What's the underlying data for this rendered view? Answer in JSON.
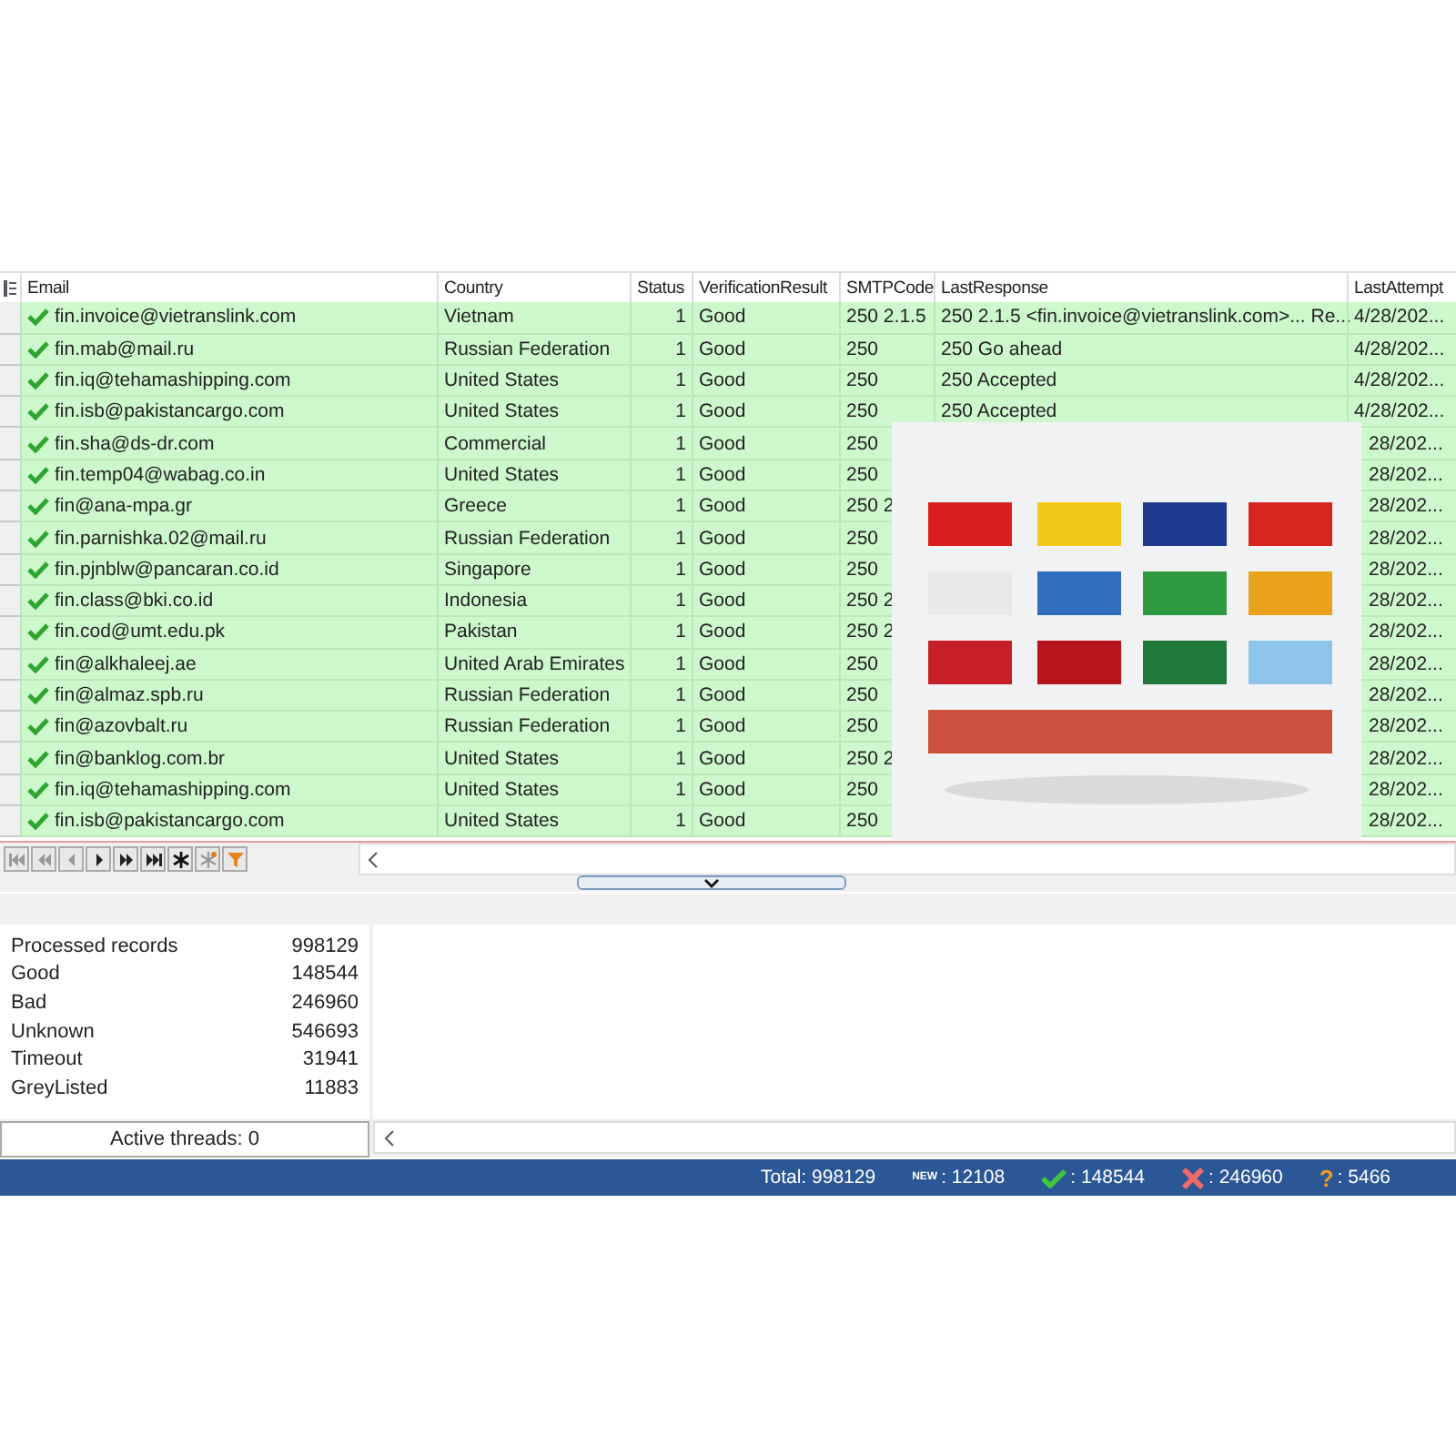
{
  "table": {
    "columns": [
      "Email",
      "Country",
      "Status",
      "VerificationResult",
      "SMTPCode",
      "LastResponse",
      "LastAttempt"
    ],
    "rows": [
      {
        "email": "fin.invoice@vietranslink.com",
        "country": "Vietnam",
        "status": "1",
        "result": "Good",
        "smtp": "250 2.1.5",
        "response": "250 2.1.5 <fin.invoice@vietranslink.com>... Re...",
        "attempt": "4/28/202..."
      },
      {
        "email": "fin.mab@mail.ru",
        "country": "Russian Federation",
        "status": "1",
        "result": "Good",
        "smtp": "250",
        "response": "250 Go ahead",
        "attempt": "4/28/202..."
      },
      {
        "email": "fin.iq@tehamashipping.com",
        "country": "United States",
        "status": "1",
        "result": "Good",
        "smtp": "250",
        "response": "250 Accepted",
        "attempt": "4/28/202..."
      },
      {
        "email": "fin.isb@pakistancargo.com",
        "country": "United States",
        "status": "1",
        "result": "Good",
        "smtp": "250",
        "response": "250 Accepted",
        "attempt": "4/28/202..."
      },
      {
        "email": "fin.sha@ds-dr.com",
        "country": "Commercial",
        "status": "1",
        "result": "Good",
        "smtp": "250",
        "attempt": "28/202..."
      },
      {
        "email": "fin.temp04@wabag.co.in",
        "country": "United States",
        "status": "1",
        "result": "Good",
        "smtp": "250",
        "attempt": "28/202..."
      },
      {
        "email": "fin@ana-mpa.gr",
        "country": "Greece",
        "status": "1",
        "result": "Good",
        "smtp": "250 2",
        "attempt": "28/202..."
      },
      {
        "email": "fin.parnishka.02@mail.ru",
        "country": "Russian Federation",
        "status": "1",
        "result": "Good",
        "smtp": "250",
        "attempt": "28/202..."
      },
      {
        "email": "fin.pjnblw@pancaran.co.id",
        "country": "Singapore",
        "status": "1",
        "result": "Good",
        "smtp": "250",
        "attempt": "28/202..."
      },
      {
        "email": "fin.class@bki.co.id",
        "country": "Indonesia",
        "status": "1",
        "result": "Good",
        "smtp": "250 2",
        "attempt": "28/202..."
      },
      {
        "email": "fin.cod@umt.edu.pk",
        "country": "Pakistan",
        "status": "1",
        "result": "Good",
        "smtp": "250 2",
        "attempt": "28/202..."
      },
      {
        "email": "fin@alkhaleej.ae",
        "country": "United Arab Emirates",
        "status": "1",
        "result": "Good",
        "smtp": "250",
        "attempt": "28/202..."
      },
      {
        "email": "fin@almaz.spb.ru",
        "country": "Russian Federation",
        "status": "1",
        "result": "Good",
        "smtp": "250",
        "attempt": "28/202..."
      },
      {
        "email": "fin@azovbalt.ru",
        "country": "Russian Federation",
        "status": "1",
        "result": "Good",
        "smtp": "250",
        "attempt": "28/202..."
      },
      {
        "email": "fin@banklog.com.br",
        "country": "United States",
        "status": "1",
        "result": "Good",
        "smtp": "250 2",
        "attempt": "28/202..."
      },
      {
        "email": "fin.iq@tehamashipping.com",
        "country": "United States",
        "status": "1",
        "result": "Good",
        "smtp": "250",
        "attempt": "28/202..."
      },
      {
        "email": "fin.isb@pakistancargo.com",
        "country": "United States",
        "status": "1",
        "result": "Good",
        "smtp": "250",
        "attempt": "28/202..."
      }
    ]
  },
  "stats": [
    {
      "label": "Processed records",
      "value": "998129"
    },
    {
      "label": "Good",
      "value": "148544"
    },
    {
      "label": "Bad",
      "value": "246960"
    },
    {
      "label": "Unknown",
      "value": "546693"
    },
    {
      "label": "Timeout",
      "value": "31941"
    },
    {
      "label": "GreyListed",
      "value": "11883"
    }
  ],
  "active_threads": "Active threads: 0",
  "status_bar": [
    {
      "kind": "text",
      "text": "Total: 998129"
    },
    {
      "kind": "new",
      "badge": "NEW",
      "text": ": 12108"
    },
    {
      "kind": "good",
      "text": ": 148544"
    },
    {
      "kind": "bad",
      "text": ": 246960"
    },
    {
      "kind": "unknown",
      "glyph": "?",
      "text": ": 5466"
    }
  ]
}
